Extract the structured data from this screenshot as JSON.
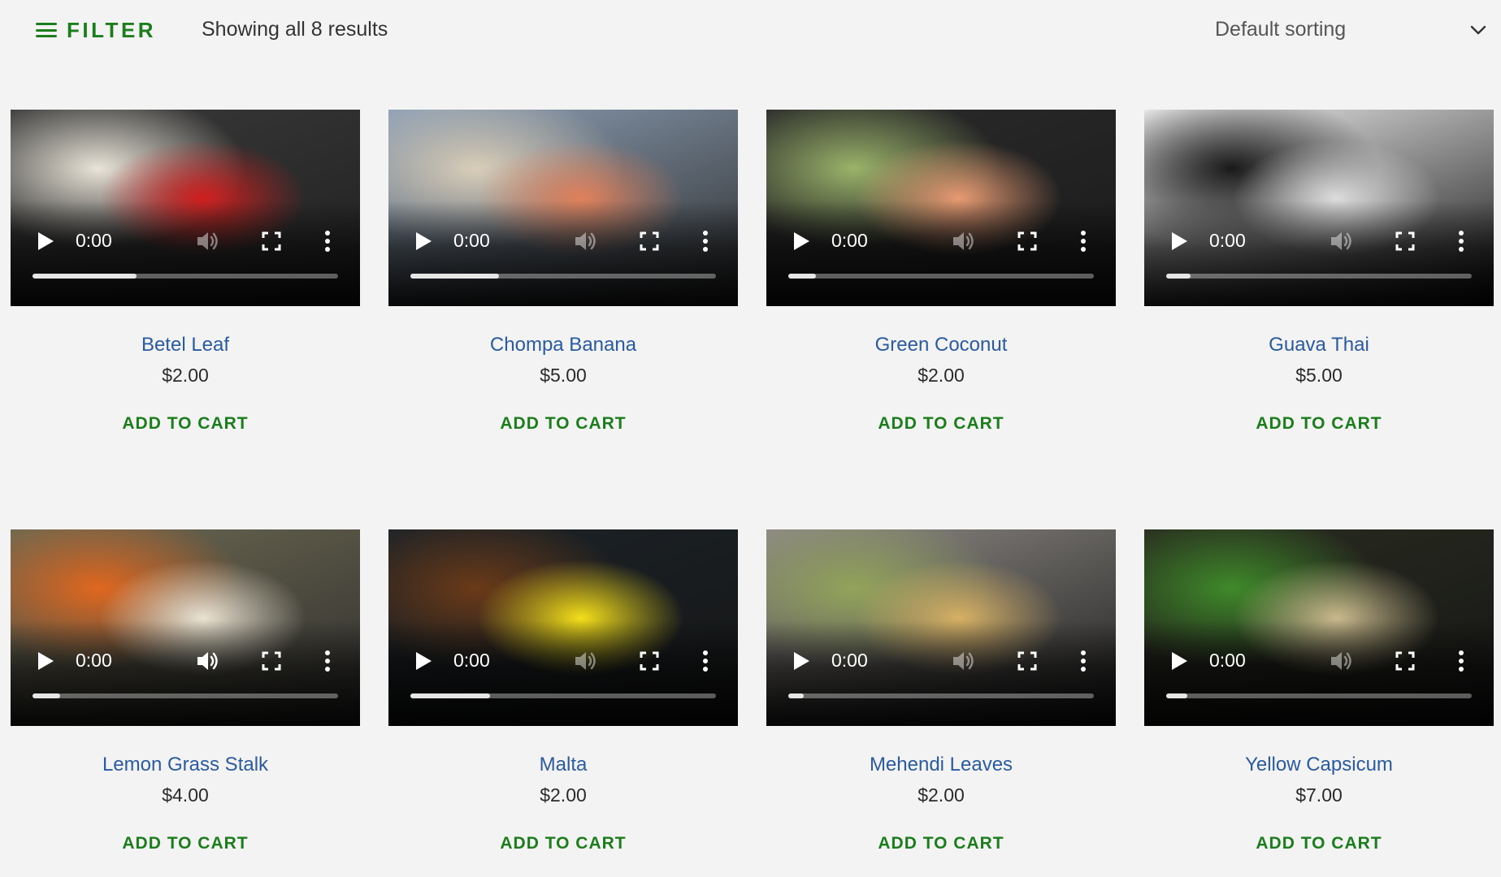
{
  "colors": {
    "accent": "#1b7d1b",
    "link": "#2a5aa0",
    "background": "#f3f3f3"
  },
  "toolbar": {
    "filter_label": "FILTER",
    "filter_icon": "hamburger-menu-icon",
    "result_count": "Showing all 8 results",
    "sort_selected": "Default sorting",
    "sort_icon": "chevron-down-icon"
  },
  "video_icons": {
    "play": "play-icon",
    "volume": "volume-icon",
    "fullscreen": "fullscreen-icon",
    "more": "more-vertical-icon"
  },
  "products": [
    {
      "name": "Betel Leaf",
      "price": "$2.00",
      "cart_label": "ADD TO CART",
      "time": "0:00",
      "progress": 0.34,
      "thumb_colors": [
        "#3a3a3a",
        "#cf1f1f",
        "#e9e4d8",
        "#1f1f1f"
      ]
    },
    {
      "name": "Chompa Banana",
      "price": "$5.00",
      "cart_label": "ADD TO CART",
      "time": "0:00",
      "progress": 0.29,
      "thumb_colors": [
        "#8fa2b8",
        "#e0805a",
        "#d9cdb8",
        "#2a2a2a"
      ]
    },
    {
      "name": "Green Coconut",
      "price": "$2.00",
      "cart_label": "ADD TO CART",
      "time": "0:00",
      "progress": 0.09,
      "thumb_colors": [
        "#2b2b2b",
        "#e79a72",
        "#9ab36a",
        "#1a1a1a"
      ]
    },
    {
      "name": "Guava Thai",
      "price": "$5.00",
      "cart_label": "ADD TO CART",
      "time": "0:00",
      "progress": 0.08,
      "thumb_colors": [
        "#f2f2f2",
        "#dcdcdc",
        "#1a1a1a",
        "#111111"
      ]
    },
    {
      "name": "Lemon Grass Stalk",
      "price": "$4.00",
      "cart_label": "ADD TO CART",
      "time": "0:00",
      "progress": 0.09,
      "thumb_colors": [
        "#6e6a52",
        "#e9e2d2",
        "#e0671f",
        "#2d2d2d"
      ]
    },
    {
      "name": "Malta",
      "price": "$2.00",
      "cart_label": "ADD TO CART",
      "time": "0:00",
      "progress": 0.26,
      "thumb_colors": [
        "#1c2328",
        "#f3de1a",
        "#6b3a18",
        "#151515"
      ]
    },
    {
      "name": "Mehendi Leaves",
      "price": "$2.00",
      "cart_label": "ADD TO CART",
      "time": "0:00",
      "progress": 0.05,
      "thumb_colors": [
        "#8f8b86",
        "#d6b064",
        "#93a45a",
        "#1c1c1c"
      ]
    },
    {
      "name": "Yellow Capsicum",
      "price": "$7.00",
      "cart_label": "ADD TO CART",
      "time": "0:00",
      "progress": 0.07,
      "thumb_colors": [
        "#2a2d20",
        "#c9b98d",
        "#3f8a2a",
        "#151515"
      ]
    }
  ]
}
